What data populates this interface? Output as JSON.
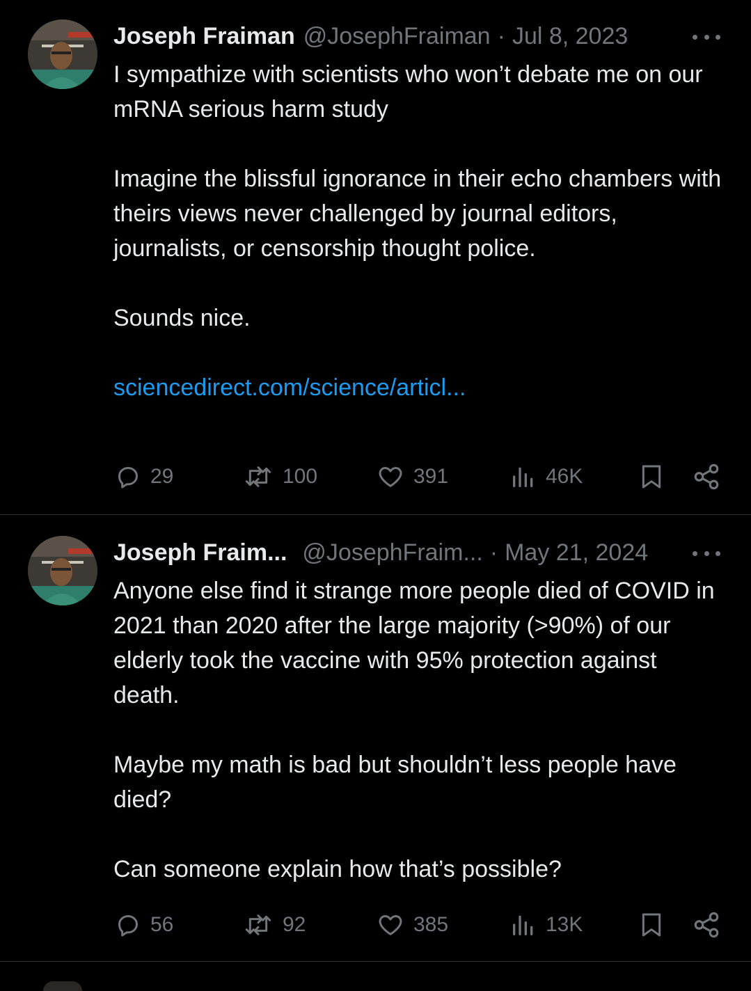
{
  "tweets": [
    {
      "name": "Joseph Fraiman",
      "handle": "@JosephFraiman",
      "separator": "·",
      "date": "Jul 8, 2023",
      "paragraphs": [
        "I sympathize with scientists who won’t debate me on our mRNA serious harm study",
        "Imagine the blissful ignorance in their echo chambers with theirs views never challenged by journal editors,  journalists, or censorship thought police.",
        "Sounds nice."
      ],
      "link": "sciencedirect.com/science/articl...",
      "replies": "29",
      "reposts": "100",
      "likes": "391",
      "views": "46K"
    },
    {
      "name": "Joseph Fraim...",
      "handle": "@JosephFraim...",
      "separator": "·",
      "date": "May 21, 2024",
      "paragraphs": [
        "Anyone else find it strange more people died of COVID in 2021 than 2020 after the large majority (>90%) of our elderly took the vaccine with 95% protection against death.",
        "Maybe my math is bad but shouldn’t less people have died?",
        "Can someone explain how that’s possible?"
      ],
      "replies": "56",
      "reposts": "92",
      "likes": "385",
      "views": "13K"
    }
  ],
  "colors": {
    "background": "#000000",
    "text": "#e7e9ea",
    "muted": "#71767b",
    "link": "#1d9bf0",
    "divider": "#2f3336"
  }
}
